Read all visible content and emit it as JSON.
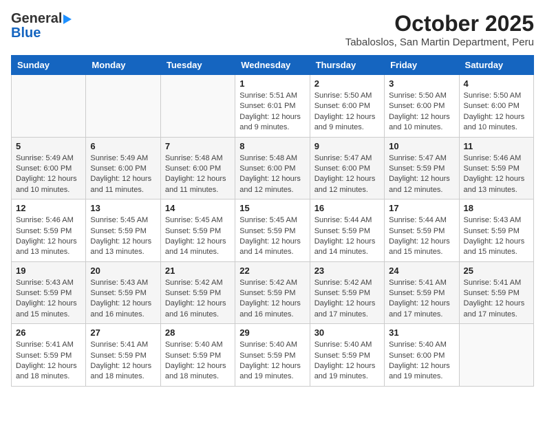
{
  "header": {
    "logo_general": "General",
    "logo_blue": "Blue",
    "title": "October 2025",
    "subtitle": "Tabaloslos, San Martin Department, Peru"
  },
  "days_of_week": [
    "Sunday",
    "Monday",
    "Tuesday",
    "Wednesday",
    "Thursday",
    "Friday",
    "Saturday"
  ],
  "weeks": [
    [
      {
        "day": "",
        "info": ""
      },
      {
        "day": "",
        "info": ""
      },
      {
        "day": "",
        "info": ""
      },
      {
        "day": "1",
        "info": "Sunrise: 5:51 AM\nSunset: 6:01 PM\nDaylight: 12 hours\nand 9 minutes."
      },
      {
        "day": "2",
        "info": "Sunrise: 5:50 AM\nSunset: 6:00 PM\nDaylight: 12 hours\nand 9 minutes."
      },
      {
        "day": "3",
        "info": "Sunrise: 5:50 AM\nSunset: 6:00 PM\nDaylight: 12 hours\nand 10 minutes."
      },
      {
        "day": "4",
        "info": "Sunrise: 5:50 AM\nSunset: 6:00 PM\nDaylight: 12 hours\nand 10 minutes."
      }
    ],
    [
      {
        "day": "5",
        "info": "Sunrise: 5:49 AM\nSunset: 6:00 PM\nDaylight: 12 hours\nand 10 minutes."
      },
      {
        "day": "6",
        "info": "Sunrise: 5:49 AM\nSunset: 6:00 PM\nDaylight: 12 hours\nand 11 minutes."
      },
      {
        "day": "7",
        "info": "Sunrise: 5:48 AM\nSunset: 6:00 PM\nDaylight: 12 hours\nand 11 minutes."
      },
      {
        "day": "8",
        "info": "Sunrise: 5:48 AM\nSunset: 6:00 PM\nDaylight: 12 hours\nand 12 minutes."
      },
      {
        "day": "9",
        "info": "Sunrise: 5:47 AM\nSunset: 6:00 PM\nDaylight: 12 hours\nand 12 minutes."
      },
      {
        "day": "10",
        "info": "Sunrise: 5:47 AM\nSunset: 5:59 PM\nDaylight: 12 hours\nand 12 minutes."
      },
      {
        "day": "11",
        "info": "Sunrise: 5:46 AM\nSunset: 5:59 PM\nDaylight: 12 hours\nand 13 minutes."
      }
    ],
    [
      {
        "day": "12",
        "info": "Sunrise: 5:46 AM\nSunset: 5:59 PM\nDaylight: 12 hours\nand 13 minutes."
      },
      {
        "day": "13",
        "info": "Sunrise: 5:45 AM\nSunset: 5:59 PM\nDaylight: 12 hours\nand 13 minutes."
      },
      {
        "day": "14",
        "info": "Sunrise: 5:45 AM\nSunset: 5:59 PM\nDaylight: 12 hours\nand 14 minutes."
      },
      {
        "day": "15",
        "info": "Sunrise: 5:45 AM\nSunset: 5:59 PM\nDaylight: 12 hours\nand 14 minutes."
      },
      {
        "day": "16",
        "info": "Sunrise: 5:44 AM\nSunset: 5:59 PM\nDaylight: 12 hours\nand 14 minutes."
      },
      {
        "day": "17",
        "info": "Sunrise: 5:44 AM\nSunset: 5:59 PM\nDaylight: 12 hours\nand 15 minutes."
      },
      {
        "day": "18",
        "info": "Sunrise: 5:43 AM\nSunset: 5:59 PM\nDaylight: 12 hours\nand 15 minutes."
      }
    ],
    [
      {
        "day": "19",
        "info": "Sunrise: 5:43 AM\nSunset: 5:59 PM\nDaylight: 12 hours\nand 15 minutes."
      },
      {
        "day": "20",
        "info": "Sunrise: 5:43 AM\nSunset: 5:59 PM\nDaylight: 12 hours\nand 16 minutes."
      },
      {
        "day": "21",
        "info": "Sunrise: 5:42 AM\nSunset: 5:59 PM\nDaylight: 12 hours\nand 16 minutes."
      },
      {
        "day": "22",
        "info": "Sunrise: 5:42 AM\nSunset: 5:59 PM\nDaylight: 12 hours\nand 16 minutes."
      },
      {
        "day": "23",
        "info": "Sunrise: 5:42 AM\nSunset: 5:59 PM\nDaylight: 12 hours\nand 17 minutes."
      },
      {
        "day": "24",
        "info": "Sunrise: 5:41 AM\nSunset: 5:59 PM\nDaylight: 12 hours\nand 17 minutes."
      },
      {
        "day": "25",
        "info": "Sunrise: 5:41 AM\nSunset: 5:59 PM\nDaylight: 12 hours\nand 17 minutes."
      }
    ],
    [
      {
        "day": "26",
        "info": "Sunrise: 5:41 AM\nSunset: 5:59 PM\nDaylight: 12 hours\nand 18 minutes."
      },
      {
        "day": "27",
        "info": "Sunrise: 5:41 AM\nSunset: 5:59 PM\nDaylight: 12 hours\nand 18 minutes."
      },
      {
        "day": "28",
        "info": "Sunrise: 5:40 AM\nSunset: 5:59 PM\nDaylight: 12 hours\nand 18 minutes."
      },
      {
        "day": "29",
        "info": "Sunrise: 5:40 AM\nSunset: 5:59 PM\nDaylight: 12 hours\nand 19 minutes."
      },
      {
        "day": "30",
        "info": "Sunrise: 5:40 AM\nSunset: 5:59 PM\nDaylight: 12 hours\nand 19 minutes."
      },
      {
        "day": "31",
        "info": "Sunrise: 5:40 AM\nSunset: 6:00 PM\nDaylight: 12 hours\nand 19 minutes."
      },
      {
        "day": "",
        "info": ""
      }
    ]
  ]
}
